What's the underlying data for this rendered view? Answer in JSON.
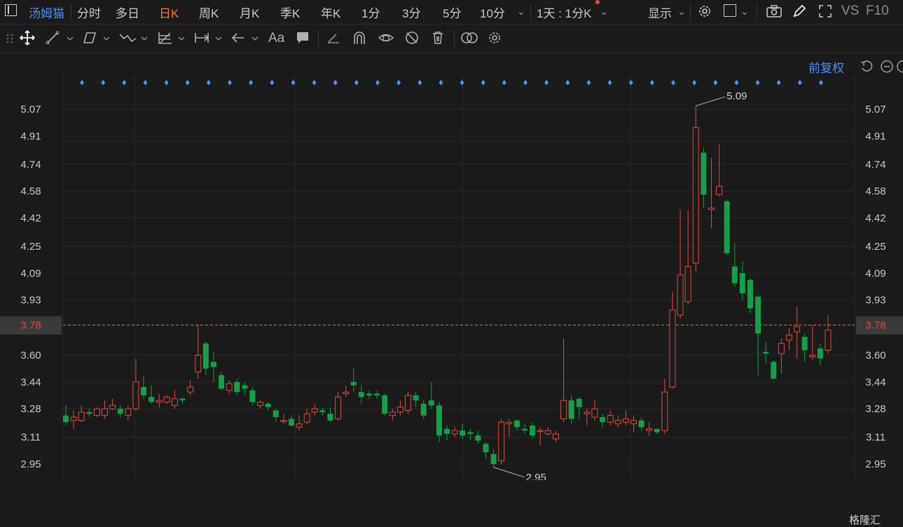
{
  "top_bar": {
    "stock_name": "汤姆猫",
    "period_tabs": [
      "分时",
      "多日",
      "日K",
      "周K",
      "月K",
      "季K",
      "年K",
      "1分",
      "3分",
      "5分",
      "10分"
    ],
    "active_tab": "日K",
    "multi_period": "1天 : 1分K",
    "display_label": "显示",
    "vs_label": "VS",
    "f10_label": "F10"
  },
  "adjust_label": "前复权",
  "watermark": "格隆汇",
  "colors": {
    "up": "#e0493f",
    "down": "#14a04a",
    "marker": "#4f8ef7",
    "price_line": "#e0743a"
  },
  "icons": [
    "panel-toggle-icon",
    "settings-icon",
    "checkbox-icon",
    "camera-icon",
    "pencil-icon",
    "fullscreen-icon",
    "move-icon",
    "line-tool-icon",
    "channel-tool-icon",
    "wave-tool-icon",
    "fib-tool-icon",
    "measure-tool-icon",
    "arrow-tool-icon",
    "text-tool-icon",
    "note-tool-icon",
    "angle-icon",
    "magnet-icon",
    "lock-eye-icon",
    "hide-icon",
    "trash-icon",
    "compare-icon",
    "gear-icon",
    "undo-icon",
    "zoom-out-icon",
    "zoom-in-icon"
  ],
  "chart_data": {
    "type": "candlestick",
    "y_ticks": [
      "5.07",
      "4.91",
      "4.74",
      "4.58",
      "4.42",
      "4.25",
      "4.09",
      "3.93",
      "3.60",
      "3.44",
      "3.28",
      "3.11",
      "2.95"
    ],
    "ylim": [
      2.9,
      5.2
    ],
    "current_price": "3.78",
    "high_label": "5.09",
    "low_label": "2.95",
    "candles": [
      [
        3.24,
        3.2,
        3.3,
        3.18
      ],
      [
        3.21,
        3.23,
        3.27,
        3.16
      ],
      [
        3.21,
        3.26,
        3.3,
        3.2
      ],
      [
        3.26,
        3.25,
        3.28,
        3.23
      ],
      [
        3.24,
        3.28,
        3.29,
        3.23
      ],
      [
        3.24,
        3.28,
        3.33,
        3.22
      ],
      [
        3.28,
        3.3,
        3.34,
        3.27
      ],
      [
        3.28,
        3.25,
        3.3,
        3.23
      ],
      [
        3.24,
        3.28,
        3.3,
        3.21
      ],
      [
        3.28,
        3.44,
        3.58,
        3.27
      ],
      [
        3.41,
        3.36,
        3.48,
        3.34
      ],
      [
        3.35,
        3.32,
        3.42,
        3.31
      ],
      [
        3.32,
        3.33,
        3.37,
        3.29
      ],
      [
        3.32,
        3.35,
        3.36,
        3.31
      ],
      [
        3.3,
        3.34,
        3.39,
        3.28
      ],
      [
        3.34,
        3.33,
        3.35,
        3.31
      ],
      [
        3.38,
        3.41,
        3.45,
        3.36
      ],
      [
        3.5,
        3.6,
        3.78,
        3.46
      ],
      [
        3.67,
        3.52,
        3.68,
        3.48
      ],
      [
        3.56,
        3.53,
        3.62,
        3.44
      ],
      [
        3.48,
        3.4,
        3.5,
        3.39
      ],
      [
        3.39,
        3.43,
        3.45,
        3.37
      ],
      [
        3.44,
        3.38,
        3.46,
        3.36
      ],
      [
        3.42,
        3.4,
        3.44,
        3.36
      ],
      [
        3.39,
        3.32,
        3.41,
        3.3
      ],
      [
        3.3,
        3.32,
        3.33,
        3.28
      ],
      [
        3.31,
        3.29,
        3.32,
        3.27
      ],
      [
        3.27,
        3.23,
        3.28,
        3.2
      ],
      [
        3.21,
        3.21,
        3.25,
        3.19
      ],
      [
        3.22,
        3.18,
        3.24,
        3.17
      ],
      [
        3.17,
        3.19,
        3.24,
        3.15
      ],
      [
        3.2,
        3.25,
        3.28,
        3.19
      ],
      [
        3.26,
        3.28,
        3.31,
        3.24
      ],
      [
        3.27,
        3.26,
        3.29,
        3.24
      ],
      [
        3.25,
        3.21,
        3.29,
        3.2
      ],
      [
        3.22,
        3.35,
        3.38,
        3.21
      ],
      [
        3.37,
        3.38,
        3.42,
        3.35
      ],
      [
        3.44,
        3.42,
        3.52,
        3.38
      ],
      [
        3.38,
        3.35,
        3.42,
        3.31
      ],
      [
        3.37,
        3.36,
        3.39,
        3.34
      ],
      [
        3.37,
        3.36,
        3.39,
        3.34
      ],
      [
        3.36,
        3.25,
        3.37,
        3.24
      ],
      [
        3.24,
        3.26,
        3.28,
        3.21
      ],
      [
        3.26,
        3.29,
        3.33,
        3.24
      ],
      [
        3.27,
        3.36,
        3.38,
        3.25
      ],
      [
        3.36,
        3.33,
        3.38,
        3.29
      ],
      [
        3.31,
        3.24,
        3.33,
        3.22
      ],
      [
        3.33,
        3.3,
        3.44,
        3.28
      ],
      [
        3.3,
        3.12,
        3.32,
        3.08
      ],
      [
        3.16,
        3.13,
        3.18,
        3.09
      ],
      [
        3.13,
        3.15,
        3.17,
        3.11
      ],
      [
        3.15,
        3.12,
        3.19,
        3.1
      ],
      [
        3.14,
        3.13,
        3.16,
        3.09
      ],
      [
        3.12,
        3.09,
        3.15,
        3.07
      ],
      [
        3.07,
        3.02,
        3.08,
        2.98
      ],
      [
        3.01,
        2.95,
        3.04,
        2.93
      ],
      [
        2.97,
        3.2,
        3.22,
        2.95
      ],
      [
        3.19,
        3.2,
        3.22,
        3.11
      ],
      [
        3.21,
        3.17,
        3.22,
        3.15
      ],
      [
        3.16,
        3.15,
        3.19,
        3.13
      ],
      [
        3.18,
        3.12,
        3.2,
        3.1
      ],
      [
        3.15,
        3.15,
        3.17,
        3.06
      ],
      [
        3.13,
        3.15,
        3.17,
        3.12
      ],
      [
        3.1,
        3.13,
        3.15,
        3.08
      ],
      [
        3.22,
        3.33,
        3.7,
        3.2
      ],
      [
        3.33,
        3.22,
        3.36,
        3.19
      ],
      [
        3.34,
        3.29,
        3.35,
        3.22
      ],
      [
        3.25,
        3.26,
        3.28,
        3.18
      ],
      [
        3.23,
        3.28,
        3.33,
        3.21
      ],
      [
        3.23,
        3.2,
        3.25,
        3.17
      ],
      [
        3.2,
        3.24,
        3.27,
        3.18
      ],
      [
        3.19,
        3.21,
        3.24,
        3.17
      ],
      [
        3.2,
        3.22,
        3.27,
        3.18
      ],
      [
        3.19,
        3.21,
        3.24,
        3.14
      ],
      [
        3.21,
        3.17,
        3.23,
        3.15
      ],
      [
        3.15,
        3.16,
        3.2,
        3.12
      ],
      [
        3.16,
        3.14,
        3.16,
        3.13
      ],
      [
        3.15,
        3.38,
        3.46,
        3.13
      ],
      [
        3.41,
        3.87,
        3.98,
        3.4
      ],
      [
        3.84,
        4.08,
        4.47,
        3.82
      ],
      [
        3.92,
        4.13,
        4.47,
        3.9
      ],
      [
        4.15,
        4.96,
        5.09,
        4.1
      ],
      [
        4.81,
        4.56,
        4.84,
        4.48
      ],
      [
        4.47,
        4.48,
        4.78,
        4.36
      ],
      [
        4.56,
        4.61,
        4.86,
        4.55
      ],
      [
        4.52,
        4.21,
        4.53,
        4.2
      ],
      [
        4.13,
        4.03,
        4.27,
        4.01
      ],
      [
        4.09,
        3.97,
        4.16,
        3.93
      ],
      [
        4.05,
        3.88,
        4.06,
        3.85
      ],
      [
        3.95,
        3.73,
        3.96,
        3.48
      ],
      [
        3.62,
        3.61,
        3.68,
        3.55
      ],
      [
        3.56,
        3.46,
        3.57,
        3.45
      ],
      [
        3.61,
        3.67,
        3.7,
        3.49
      ],
      [
        3.69,
        3.72,
        3.76,
        3.63
      ],
      [
        3.74,
        3.77,
        3.89,
        3.58
      ],
      [
        3.71,
        3.63,
        3.73,
        3.56
      ],
      [
        3.59,
        3.6,
        3.78,
        3.57
      ],
      [
        3.64,
        3.58,
        3.67,
        3.54
      ],
      [
        3.63,
        3.75,
        3.84,
        3.61
      ]
    ],
    "event_marker_count": 36
  }
}
